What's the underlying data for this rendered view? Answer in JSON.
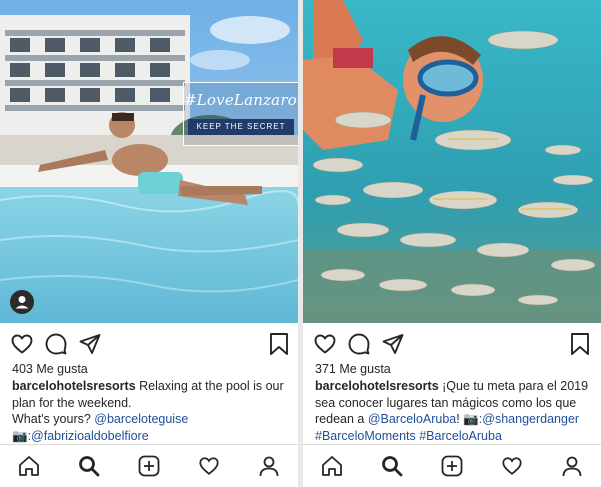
{
  "posts": [
    {
      "likes": "403 Me gusta",
      "username": "barcelohotelsresorts",
      "caption_line1": " Relaxing at the pool is our plan for the weekend.",
      "caption_line2": "What's yours? ",
      "mention1": "@barceloteguise",
      "camera_emoji": "📷",
      "mention2": ":@fabrizioaldobelfiore",
      "overlay_title": "#LoveLanzarote",
      "overlay_sub": "KEEP THE SECRET"
    },
    {
      "likes": "371 Me gusta",
      "username": "barcelohotelsresorts",
      "caption_line1": " ¡Que tu meta para el 2019 sea conocer lugares tan mágicos como los que redean a ",
      "mention1": "@BarceloAruba",
      "text_mid": "! ",
      "camera_emoji": "📷",
      "mention2": ":@shangerdanger",
      "hashtags": "#BarceloMoments #BarceloAruba"
    }
  ],
  "icons": {
    "like": "heart-icon",
    "comment": "comment-icon",
    "share": "send-icon",
    "save": "bookmark-icon",
    "nav": [
      "home-icon",
      "search-icon",
      "add-post-icon",
      "activity-heart-icon",
      "profile-icon"
    ]
  },
  "colors": {
    "link": "#1f4f9a",
    "text": "#262626",
    "overlay_band": "#213c6b"
  }
}
